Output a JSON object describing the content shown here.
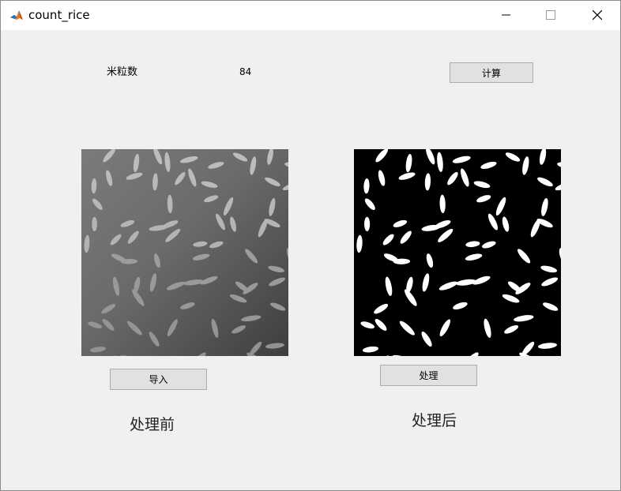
{
  "window": {
    "title": "count_rice",
    "app_icon": "matlab-icon"
  },
  "controls": {
    "count_label": "米粒数",
    "count_value": "84",
    "compute_button": "计算",
    "import_button": "导入",
    "process_button": "处理"
  },
  "captions": {
    "before": "处理前",
    "after": "处理后"
  },
  "colors": {
    "background": "#f0f0f0",
    "button_face": "#e1e1e1",
    "button_border": "#adadad"
  },
  "icons": {
    "minimize": "minimize-icon",
    "maximize": "maximize-icon",
    "close": "close-icon"
  }
}
